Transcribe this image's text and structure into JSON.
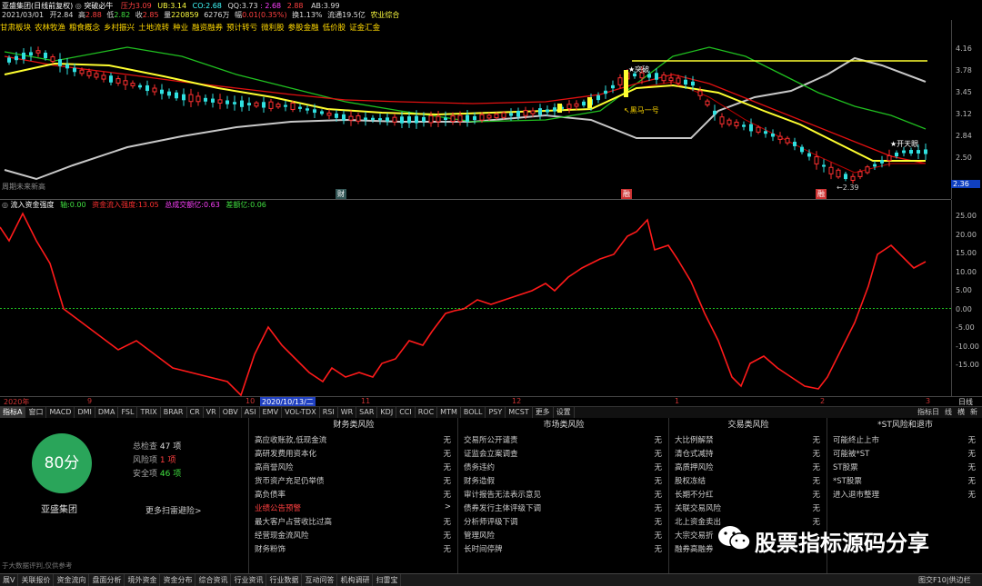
{
  "header": {
    "stock_name": "亚盛集团(日线前复权)",
    "indicator_name": "突破必牛",
    "pressure_label": "压力",
    "pressure_val": "3.09",
    "ub_label": "UB:",
    "ub_val": "3.14",
    "co_label": "CO:",
    "co_val": "2.68",
    "qq_label": "QQ:",
    "qq_val": "3.73",
    "qq_tail": ": 2.68",
    "qq_tail2": "2.88",
    "ab_label": "AB:",
    "ab_val": "3.99",
    "date": "2021/03/01",
    "open_label": "开",
    "open_val": "2.84",
    "high_label": "高",
    "high_val": "2.88",
    "low_label": "低",
    "low_val": "2.82",
    "close_label": "收",
    "close_val": "2.85",
    "vol_label": "量",
    "vol_val": "220859",
    "amount_val": "6276万",
    "chg_label": "幅",
    "chg_val": "0.01(0.35%)",
    "turnover_label": "换",
    "turnover_val": "1.13%",
    "float_label": "流通",
    "float_val": "19.5亿",
    "industry": "农业综合"
  },
  "indicator_tags": [
    "甘肃板块",
    "农林牧渔",
    "粮食概念",
    "乡村振兴",
    "土地流转",
    "种业",
    "融资融券",
    "预计转亏",
    "微利股",
    "参股金融",
    "低价股",
    "证金汇金"
  ],
  "main_axis": [
    "4.16",
    "3.78",
    "3.45",
    "3.12",
    "2.84",
    "2.50"
  ],
  "main_axis_last": "2.36",
  "annotations": {
    "breakout": "突破",
    "black_horse": "黑马一号",
    "kaitian": "开天眼",
    "low_price": "2.39",
    "bottom_left": "周期未来新高",
    "mark_cai": "财",
    "mark_rong": "融"
  },
  "sub_legend": {
    "name": "流入资金强度",
    "zhou_label": "轴:",
    "zhou_val": "0.00",
    "fund_label": "资金流入强度:",
    "fund_val": "13.05",
    "total_label": "总成交额亿:",
    "total_val": "0.63",
    "diff_label": "差额亿:",
    "diff_val": "0.06"
  },
  "sub_axis": [
    "25.00",
    "20.00",
    "15.00",
    "10.00",
    "5.00",
    "0.00",
    "-5.00",
    "-10.00",
    "-15.00"
  ],
  "datebar": {
    "y2020": "2020年",
    "m9": "9",
    "m10": "10",
    "cursor_date": "2020/10/13/二",
    "m11": "11",
    "m12": "12",
    "m1": "1",
    "m2": "2",
    "m3": "3",
    "period": "日线"
  },
  "tabs": [
    "指标A",
    "窗口",
    "MACD",
    "DMI",
    "DMA",
    "FSL",
    "TRIX",
    "BRAR",
    "CR",
    "VR",
    "OBV",
    "ASI",
    "EMV",
    "VOL-TDX",
    "RSI",
    "WR",
    "SAR",
    "KDJ",
    "CCI",
    "ROC",
    "MTM",
    "BOLL",
    "PSY",
    "MCST",
    "更多",
    "设置"
  ],
  "tabs_right": [
    "指标日",
    "线",
    "横",
    "新"
  ],
  "risk": {
    "score": "80分",
    "company": "亚盛集团",
    "check_label": "总检查",
    "check_val": "47 项",
    "risk_label": "风险项",
    "risk_val": "1 项",
    "safe_label": "安全项",
    "safe_val": "46 项",
    "more": "更多扫雷避险>",
    "note": "于大数据评判,仅供参考",
    "financial": {
      "title": "财务类风险",
      "items": [
        {
          "name": "高应收账款,低现金流",
          "v": "无"
        },
        {
          "name": "高研发费用资本化",
          "v": "无"
        },
        {
          "name": "高商誉风险",
          "v": "无"
        },
        {
          "name": "货币资产充足仍举债",
          "v": "无"
        },
        {
          "name": "高负债率",
          "v": "无"
        },
        {
          "name": "业绩公告预警",
          "v": ">"
        },
        {
          "name": "最大客户占营收比过高",
          "v": "无"
        },
        {
          "name": "经营现金流风险",
          "v": "无"
        },
        {
          "name": "财务粉饰",
          "v": "无"
        }
      ]
    },
    "market": {
      "title": "市场类风险",
      "items": [
        {
          "name": "交易所公开谴责",
          "v": "无"
        },
        {
          "name": "证监会立案调查",
          "v": "无"
        },
        {
          "name": "债务违约",
          "v": "无"
        },
        {
          "name": "财务造假",
          "v": "无"
        },
        {
          "name": "审计报告无法表示意见",
          "v": "无"
        },
        {
          "name": "债券发行主体评级下调",
          "v": "无"
        },
        {
          "name": "分析师评级下调",
          "v": "无"
        },
        {
          "name": "管理风险",
          "v": "无"
        },
        {
          "name": "长时间停牌",
          "v": "无"
        }
      ]
    },
    "trade": {
      "title": "交易类风险",
      "items": [
        {
          "name": "大比例解禁",
          "v": "无"
        },
        {
          "name": "清仓式减持",
          "v": "无"
        },
        {
          "name": "高质押风险",
          "v": "无"
        },
        {
          "name": "股权冻结",
          "v": "无"
        },
        {
          "name": "长期不分红",
          "v": "无"
        },
        {
          "name": "关联交易风险",
          "v": "无"
        },
        {
          "name": "北上资金卖出",
          "v": "无"
        },
        {
          "name": "大宗交易折",
          "v": ""
        },
        {
          "name": "融券高融券",
          "v": ""
        }
      ]
    },
    "st": {
      "title": "*ST风险和退市",
      "items": [
        {
          "name": "可能终止上市",
          "v": "无"
        },
        {
          "name": "可能被*ST",
          "v": "无"
        },
        {
          "name": "ST股票",
          "v": "无"
        },
        {
          "name": "*ST股票",
          "v": "无"
        },
        {
          "name": "进入退市整理",
          "v": "无"
        }
      ]
    },
    "watermark": "股票指标源码分享"
  },
  "bottombar": [
    "展V",
    "关联报价",
    "资金流向",
    "盘面分析",
    "境外资金",
    "资金分布",
    "综合资讯",
    "行业资讯",
    "行业数据",
    "互动问答",
    "机构调研",
    "扫雷宝"
  ],
  "bottombar_right": "图交F10|供边栏",
  "colors": {
    "up": "#ff3030",
    "down": "#30e0e0",
    "ma_yellow": "#ffff30",
    "ma_gray": "#c8c8c8",
    "ma_green": "#20c020",
    "ma_red": "#e01010",
    "score_green": "#2aa55a"
  }
}
